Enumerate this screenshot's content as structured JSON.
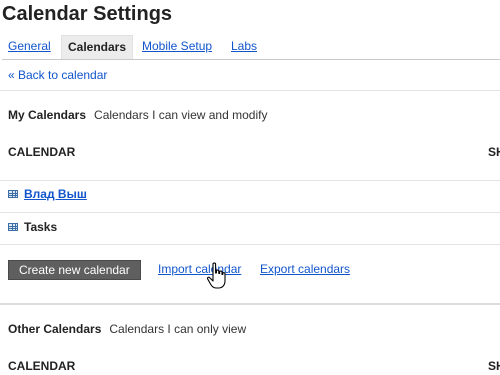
{
  "page": {
    "title": "Calendar Settings"
  },
  "tabs": [
    {
      "label": "General",
      "active": false
    },
    {
      "label": "Calendars",
      "active": true
    },
    {
      "label": "Mobile Setup",
      "active": false
    },
    {
      "label": "Labs",
      "active": false
    }
  ],
  "back_link": "« Back to calendar",
  "my_calendars": {
    "heading": "My Calendars",
    "description": "Calendars I can view and modify",
    "column_header": "CALENDAR",
    "column_header_right": "SH",
    "items": [
      {
        "name": "Влад Выш",
        "icon": "calendar-grid-icon"
      },
      {
        "name": "Tasks",
        "icon": "calendar-grid-icon"
      }
    ],
    "actions": {
      "create": "Create new calendar",
      "import": "Import calendar",
      "export": "Export calendars"
    }
  },
  "other_calendars": {
    "heading": "Other Calendars",
    "description": "Calendars I can only view",
    "column_header": "CALENDAR",
    "column_header_right": "SH"
  },
  "colors": {
    "link": "#1155cc",
    "create_button_bg": "#5f5f5f",
    "active_tab_bg": "#ececec"
  }
}
